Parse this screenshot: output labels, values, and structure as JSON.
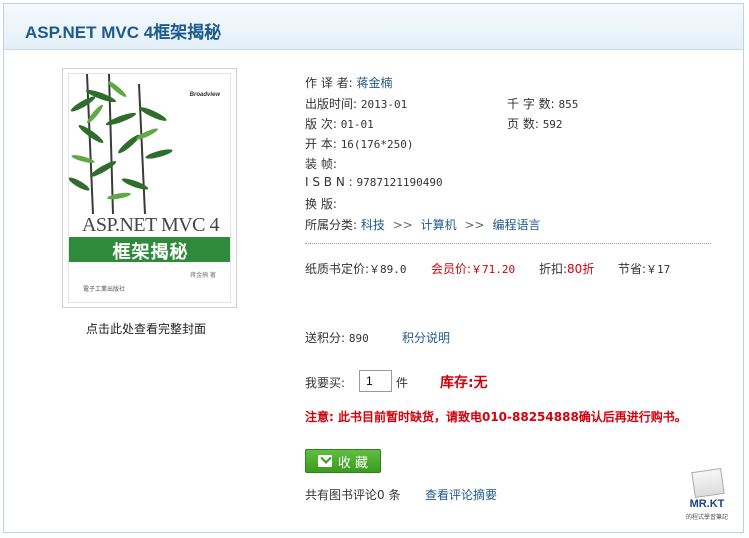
{
  "title": "ASP.NET MVC 4框架揭秘",
  "cover": {
    "publisher_logo": "Broadview",
    "book_title": "ASP.NET MVC 4",
    "subtitle": "框架揭秘",
    "author_line": "蒋金楠 著",
    "press": "電子工業出版社",
    "caption": "点击此处查看完整封面"
  },
  "info": {
    "author_label": "作 译 者:",
    "author_value": "蒋金楠",
    "pubdate_label": "出版时间:",
    "pubdate_value": "2013-01",
    "words_label": "千 字 数:",
    "words_value": "855",
    "edition_label": "版      次:",
    "edition_value": "01-01",
    "pages_label": "页      数:",
    "pages_value": "592",
    "format_label": "开      本:",
    "format_value": "16(176*250)",
    "binding_label": "装      帧:",
    "binding_value": "",
    "isbn_label": "I S B N :",
    "isbn_value": "9787121190490",
    "change_label": "换      版:",
    "change_value": "",
    "category_label": "所属分类:",
    "categories": [
      "科技",
      "计算机",
      "编程语言"
    ],
    "category_separator": ">>"
  },
  "price": {
    "list_label": "纸质书定价:",
    "list_value": "￥89.0",
    "member_label": "会员价:",
    "member_value": "￥71.20",
    "discount_label": "折扣:",
    "discount_value": "80折",
    "save_label": "节省:",
    "save_value": "￥17"
  },
  "points": {
    "label": "送积分:",
    "value": "890",
    "help_link": "积分说明"
  },
  "buy": {
    "label": "我要买:",
    "quantity": "1",
    "unit": "件",
    "stock": "库存:无"
  },
  "notice": "注意: 此书目前暂时缺货，请致电010-88254888确认后再进行购书。",
  "favorite_label": "收 藏",
  "reviews": {
    "count_text": "共有图书评论0 条",
    "summary_link": "查看评论摘要"
  },
  "watermark": {
    "text": "MR.KT",
    "sub": "的程式學習筆記"
  }
}
